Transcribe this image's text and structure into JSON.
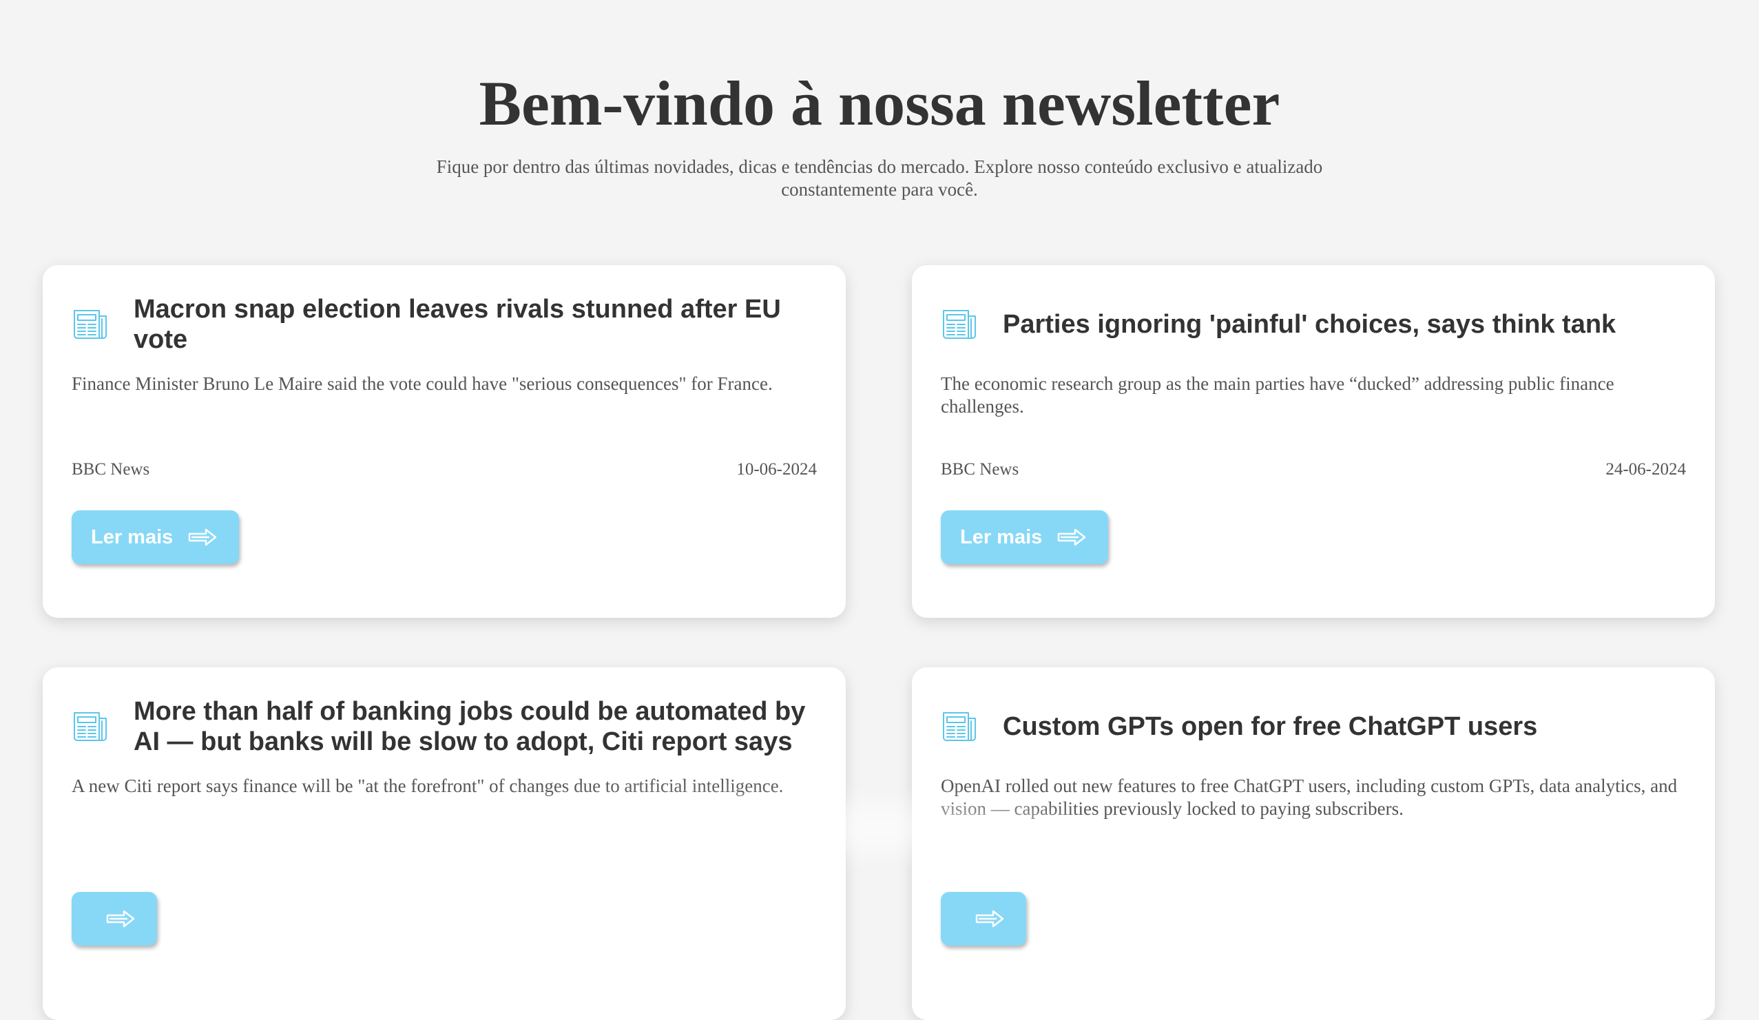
{
  "header": {
    "title": "Bem-vindo à nossa newsletter",
    "subtitle": "Fique por dentro das últimas novidades, dicas e tendências do mercado. Explore nosso conteúdo exclusivo e atualizado constantemente para você."
  },
  "colors": {
    "background": "#f4f4f4",
    "card": "#ffffff",
    "accent": "#87d8f7",
    "icon": "#5bc6ea",
    "text": "#333333"
  },
  "articles": [
    {
      "icon": "newspaper-icon",
      "title": "Macron snap election leaves rivals stunned after EU vote",
      "description": "Finance Minister Bruno Le Maire said the vote could have \"serious consequences\" for France.",
      "source": "BBC News",
      "date": "10-06-2024",
      "button_label": "Ler mais",
      "button_icon": "arrow-right-icon"
    },
    {
      "icon": "newspaper-icon",
      "title": "Parties ignoring 'painful' choices, says think tank",
      "description": "The economic research group as the main parties have “ducked” addressing public finance challenges.",
      "source": "BBC News",
      "date": "24-06-2024",
      "button_label": "Ler mais",
      "button_icon": "arrow-right-icon"
    },
    {
      "icon": "newspaper-icon",
      "title": "More than half of banking jobs could be automated by AI — but banks will be slow to adopt, Citi report says",
      "description": "A new Citi report says finance will be \"at the forefront\" of changes due to artificial intelligence.",
      "source": "",
      "date": "",
      "button_label": "",
      "button_icon": "arrow-right-icon"
    },
    {
      "icon": "newspaper-icon",
      "title": "Custom GPTs open for free ChatGPT users",
      "description": "OpenAI rolled out new features to free ChatGPT users, including custom GPTs, data analytics, and vision — capabilities previously locked to paying subscribers.",
      "source": "",
      "date": "",
      "button_label": "",
      "button_icon": "arrow-right-icon"
    }
  ]
}
